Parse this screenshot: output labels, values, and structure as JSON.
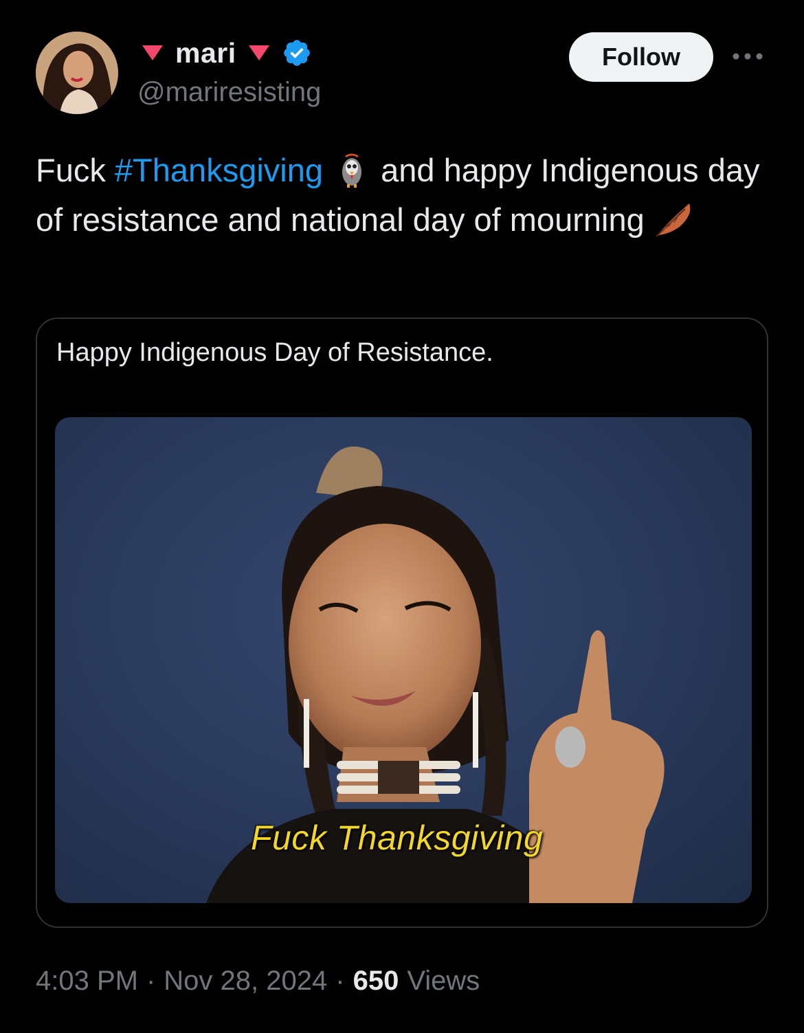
{
  "author": {
    "display_name": "mari",
    "handle": "@mariresisting",
    "verified": true,
    "name_icon": "red-down-triangle-icon",
    "accent_color": "#f4476b"
  },
  "follow_label": "Follow",
  "tweet": {
    "text_before": "Fuck ",
    "hashtag": "#Thanksgiving",
    "emoji_1": "turkey-icon",
    "text_after": " and happy Indigenous day of resistance and national day of mourning",
    "emoji_2": "feather-icon"
  },
  "quote": {
    "caption": "Happy Indigenous Day of Resistance.",
    "image_subtitle": "Fuck Thanksgiving"
  },
  "meta": {
    "time": "4:03 PM",
    "sep": "·",
    "date": "Nov 28, 2024",
    "views_count": "650",
    "views_label": "Views"
  },
  "colors": {
    "background": "#000000",
    "text": "#e7e9ea",
    "secondary": "#71767b",
    "link": "#1d9bf0",
    "verified": "#1d9bf0"
  }
}
